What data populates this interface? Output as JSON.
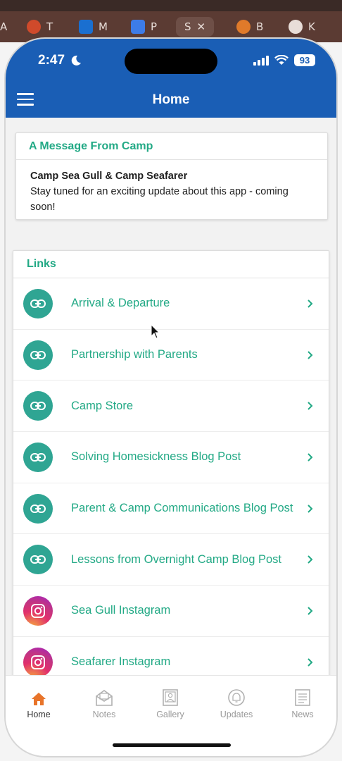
{
  "host_tabs": [
    {
      "label": "A"
    },
    {
      "label": "T"
    },
    {
      "label": "M"
    },
    {
      "label": "P"
    },
    {
      "label": "S"
    },
    {
      "label": "B"
    },
    {
      "label": "K"
    }
  ],
  "status": {
    "time": "2:47",
    "battery": "93"
  },
  "header": {
    "title": "Home"
  },
  "message_card": {
    "heading": "A Message From Camp",
    "title": "Camp Sea Gull & Camp Seafarer",
    "body": "Stay tuned for an exciting update about this app - coming soon!"
  },
  "links": {
    "heading": "Links",
    "items": [
      {
        "label": "Arrival & Departure",
        "icon": "link-icon"
      },
      {
        "label": "Partnership with Parents",
        "icon": "link-icon"
      },
      {
        "label": "Camp Store",
        "icon": "link-icon"
      },
      {
        "label": "Solving Homesickness Blog Post",
        "icon": "link-icon"
      },
      {
        "label": "Parent & Camp Communications Blog Post",
        "icon": "link-icon"
      },
      {
        "label": "Lessons from Overnight Camp Blog Post",
        "icon": "link-icon"
      },
      {
        "label": "Sea Gull Instagram",
        "icon": "instagram-icon"
      },
      {
        "label": "Seafarer Instagram",
        "icon": "instagram-icon"
      }
    ]
  },
  "bottom_nav": [
    {
      "label": "Home",
      "icon": "home-icon",
      "active": true
    },
    {
      "label": "Notes",
      "icon": "mail-icon"
    },
    {
      "label": "Gallery",
      "icon": "gallery-icon"
    },
    {
      "label": "Updates",
      "icon": "bell-icon"
    },
    {
      "label": "News",
      "icon": "newspaper-icon"
    }
  ],
  "colors": {
    "app_bar": "#1a5eb5",
    "accent_green": "#22a985",
    "link_icon_bg": "#2fa593",
    "active_nav": "#e8742a"
  }
}
